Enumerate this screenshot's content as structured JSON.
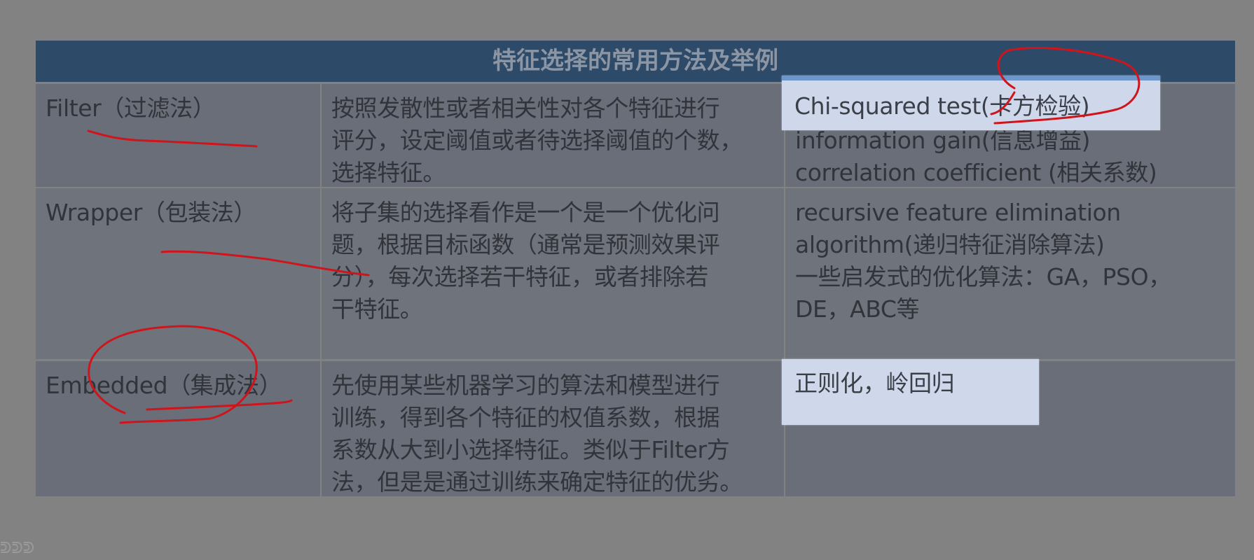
{
  "table": {
    "title": "特征选择的常用方法及举例",
    "rows": [
      {
        "method": "Filter（过滤法）",
        "description": [
          "按照发散性或者相关性对各个特征进行",
          "评分，设定阈值或者待选择阈值的个数，",
          "选择特征。"
        ],
        "examples": [
          "Chi-squared test(卡方检验)",
          "information gain(信息增益)",
          "correlation coefficient (相关系数)"
        ]
      },
      {
        "method": "Wrapper（包装法）",
        "description": [
          "将子集的选择看作是一个是一个优化问",
          "题，根据目标函数（通常是预测效果评",
          "分），每次选择若干特征，或者排除若",
          "干特征。"
        ],
        "examples": [
          "recursive feature elimination",
          "algorithm(递归特征消除算法)",
          "一些启发式的优化算法：GA，PSO，",
          "DE，ABC等"
        ]
      },
      {
        "method": "Embedded（集成法）",
        "description": [
          "先使用某些机器学习的算法和模型进行",
          "训练，得到各个特征的权值系数，根据",
          "系数从大到小选择特征。类似于Filter方",
          "法，但是是通过训练来确定特征的优劣。"
        ],
        "examples": [
          "正则化，岭回归"
        ]
      }
    ]
  },
  "colors": {
    "title_bar": "#2d4a68",
    "cell": "#6a6e78",
    "highlight": "#cfd8ea",
    "ink": "#d0141c"
  },
  "annotations": {
    "ink_color": "red",
    "highlights": [
      "Chi-squared test(卡方检验)",
      "正则化，岭回归"
    ]
  },
  "footer": {
    "corner_marks": "ᕲᕲᕲ"
  }
}
